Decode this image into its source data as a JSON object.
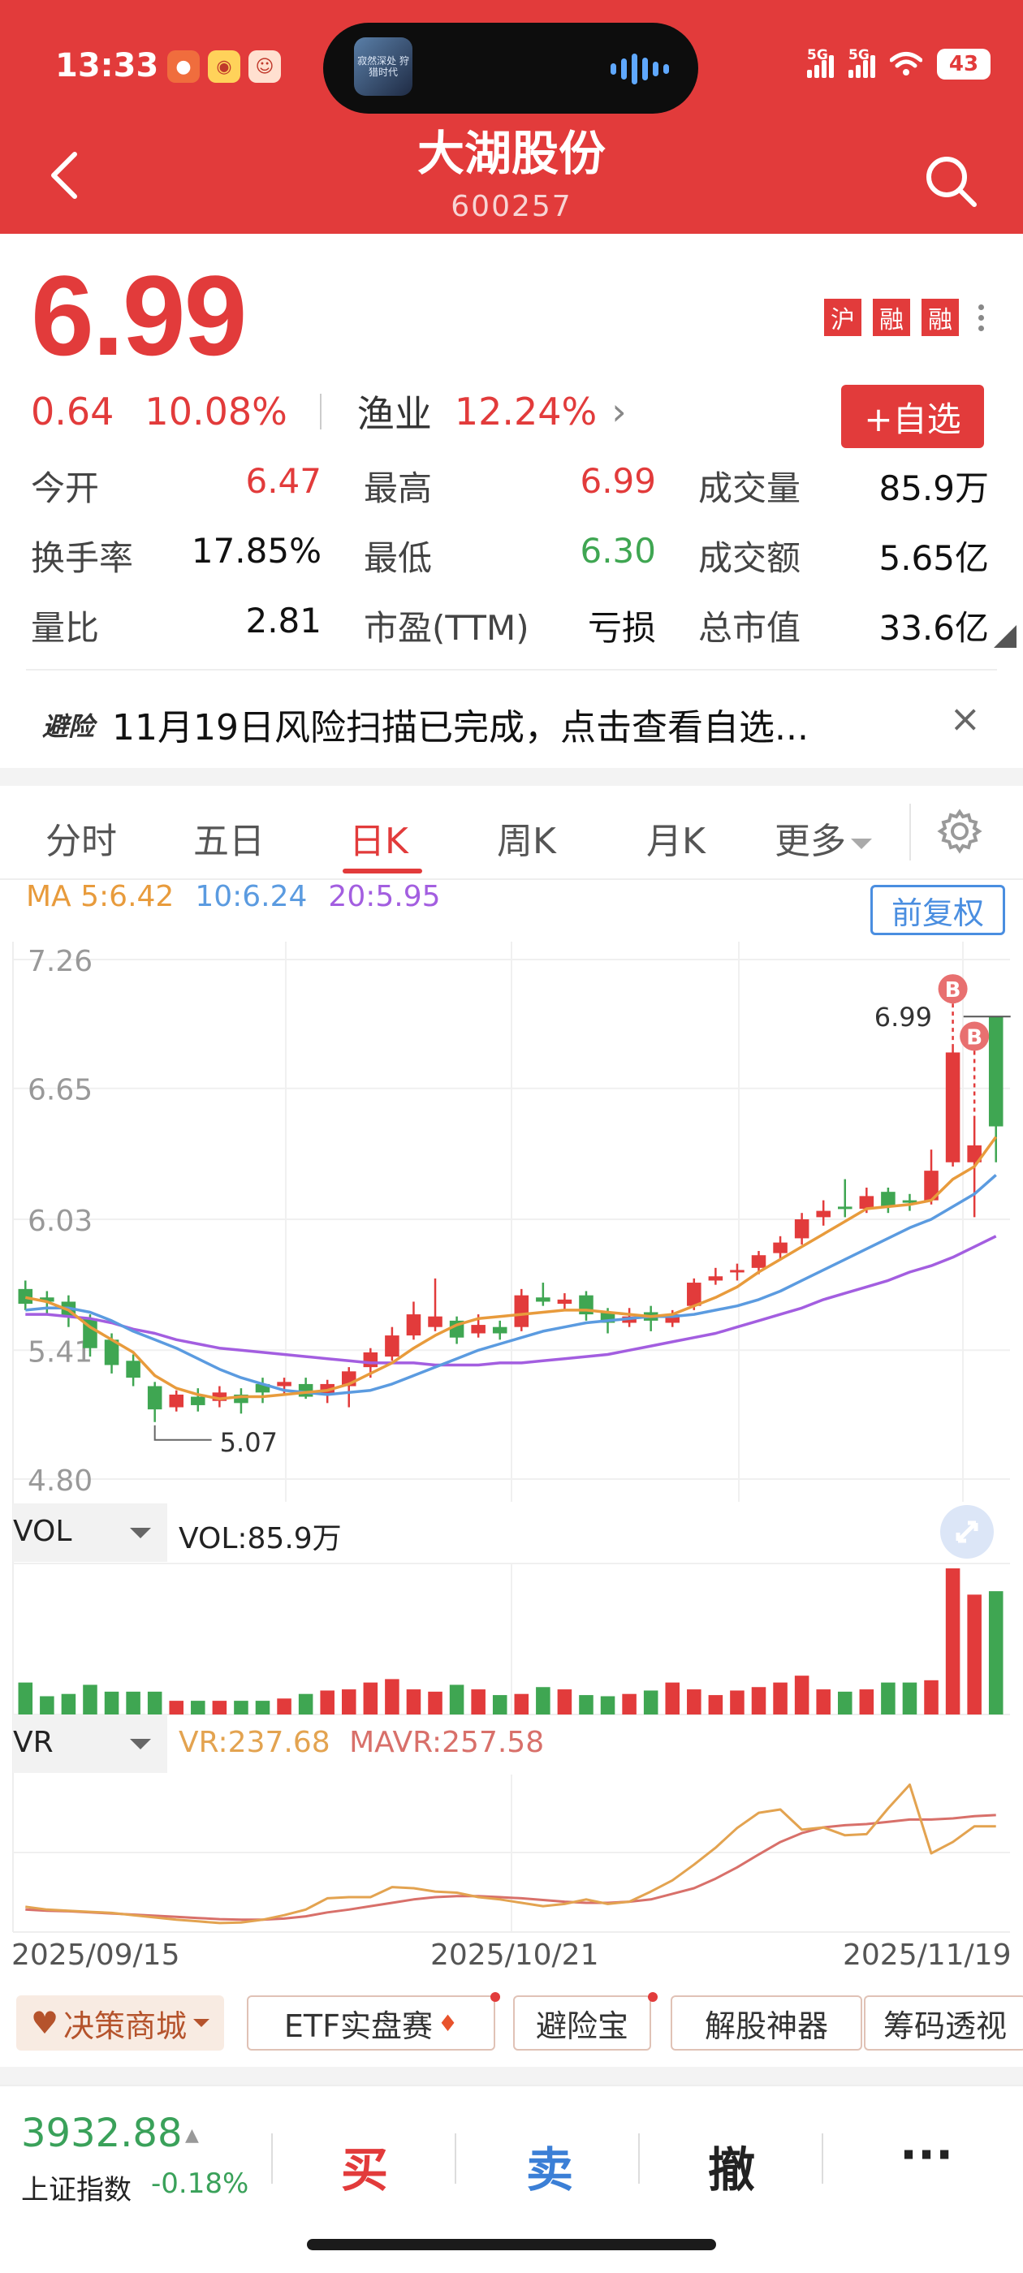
{
  "status_bar": {
    "time": "13:33",
    "battery": "43",
    "net1": "5G",
    "net2": "5G"
  },
  "island": {
    "thumb_text": "寂然深处 狩猎时代"
  },
  "header": {
    "title": "大湖股份",
    "code": "600257"
  },
  "quote": {
    "price": "6.99",
    "change": "0.64",
    "change_pct": "10.08%",
    "sector": "渔业",
    "sector_pct": "12.24%",
    "sector_arrow": "›",
    "market_tags": [
      "沪",
      "融",
      "融"
    ],
    "watch_button": "+自选",
    "stats": [
      {
        "label": "今开",
        "value": "6.47"
      },
      {
        "label": "最高",
        "value": "6.99"
      },
      {
        "label": "成交量",
        "value": "85.9万"
      },
      {
        "label": "换手率",
        "value": "17.85%"
      },
      {
        "label": "最低",
        "value": "6.30"
      },
      {
        "label": "成交额",
        "value": "5.65亿"
      },
      {
        "label": "量比",
        "value": "2.81"
      },
      {
        "label": "市盈(TTM)",
        "value": "亏损"
      },
      {
        "label": "总市值",
        "value": "33.6亿"
      }
    ]
  },
  "announcement": {
    "badge": "避险",
    "text": "11月19日风险扫描已完成，点击查看自选...",
    "close": "×"
  },
  "tabs": {
    "items": [
      "分时",
      "五日",
      "日K",
      "周K",
      "月K",
      "更多"
    ],
    "active": "日K"
  },
  "ma_legend": {
    "ma5": "MA 5:6.42",
    "ma10": "10:6.24",
    "ma20": "20:5.95",
    "adjust_button": "前复权"
  },
  "colors": {
    "up": "#e23b3b",
    "down": "#3fa652",
    "ma5": "#e89b3c",
    "ma10": "#5b9be0",
    "ma20": "#a35ee0",
    "vr": "#e3a350",
    "mavr": "#d8706a"
  },
  "chart_data": [
    {
      "type": "candlestick",
      "title": "日K",
      "y_ticks": [
        "7.26",
        "6.65",
        "6.03",
        "5.41",
        "4.80"
      ],
      "ylim": [
        4.8,
        7.26
      ],
      "x_ticks": [
        "2025/09/15",
        "2025/10/21",
        "2025/11/19"
      ],
      "annotations": [
        {
          "text": "5.07",
          "kind": "low"
        },
        {
          "text": "6.99",
          "kind": "high"
        },
        {
          "text": "B",
          "kind": "buy"
        },
        {
          "text": "B",
          "kind": "buy"
        }
      ],
      "candles": [
        {
          "o": 5.7,
          "c": 5.63,
          "h": 5.74,
          "l": 5.6
        },
        {
          "o": 5.66,
          "c": 5.64,
          "h": 5.69,
          "l": 5.58
        },
        {
          "o": 5.64,
          "c": 5.57,
          "h": 5.67,
          "l": 5.52
        },
        {
          "o": 5.56,
          "c": 5.42,
          "h": 5.58,
          "l": 5.38
        },
        {
          "o": 5.46,
          "c": 5.34,
          "h": 5.49,
          "l": 5.3
        },
        {
          "o": 5.36,
          "c": 5.28,
          "h": 5.39,
          "l": 5.24
        },
        {
          "o": 5.24,
          "c": 5.13,
          "h": 5.26,
          "l": 5.07
        },
        {
          "o": 5.14,
          "c": 5.2,
          "h": 5.22,
          "l": 5.12
        },
        {
          "o": 5.19,
          "c": 5.15,
          "h": 5.23,
          "l": 5.12
        },
        {
          "o": 5.17,
          "c": 5.21,
          "h": 5.24,
          "l": 5.14
        },
        {
          "o": 5.2,
          "c": 5.16,
          "h": 5.23,
          "l": 5.11
        },
        {
          "o": 5.25,
          "c": 5.21,
          "h": 5.28,
          "l": 5.16
        },
        {
          "o": 5.24,
          "c": 5.26,
          "h": 5.28,
          "l": 5.2
        },
        {
          "o": 5.25,
          "c": 5.19,
          "h": 5.28,
          "l": 5.18
        },
        {
          "o": 5.2,
          "c": 5.25,
          "h": 5.27,
          "l": 5.16
        },
        {
          "o": 5.24,
          "c": 5.31,
          "h": 5.33,
          "l": 5.14
        },
        {
          "o": 5.33,
          "c": 5.4,
          "h": 5.42,
          "l": 5.28
        },
        {
          "o": 5.38,
          "c": 5.48,
          "h": 5.52,
          "l": 5.36
        },
        {
          "o": 5.48,
          "c": 5.58,
          "h": 5.64,
          "l": 5.46
        },
        {
          "o": 5.52,
          "c": 5.57,
          "h": 5.75,
          "l": 5.5
        },
        {
          "o": 5.55,
          "c": 5.47,
          "h": 5.57,
          "l": 5.44
        },
        {
          "o": 5.49,
          "c": 5.53,
          "h": 5.58,
          "l": 5.47
        },
        {
          "o": 5.52,
          "c": 5.49,
          "h": 5.55,
          "l": 5.46
        },
        {
          "o": 5.52,
          "c": 5.67,
          "h": 5.7,
          "l": 5.5
        },
        {
          "o": 5.66,
          "c": 5.64,
          "h": 5.73,
          "l": 5.62
        },
        {
          "o": 5.63,
          "c": 5.65,
          "h": 5.68,
          "l": 5.6
        },
        {
          "o": 5.67,
          "c": 5.58,
          "h": 5.69,
          "l": 5.55
        },
        {
          "o": 5.59,
          "c": 5.54,
          "h": 5.61,
          "l": 5.49
        },
        {
          "o": 5.54,
          "c": 5.57,
          "h": 5.61,
          "l": 5.52
        },
        {
          "o": 5.59,
          "c": 5.55,
          "h": 5.62,
          "l": 5.5
        },
        {
          "o": 5.54,
          "c": 5.58,
          "h": 5.6,
          "l": 5.52
        },
        {
          "o": 5.62,
          "c": 5.73,
          "h": 5.75,
          "l": 5.6
        },
        {
          "o": 5.74,
          "c": 5.76,
          "h": 5.8,
          "l": 5.72
        },
        {
          "o": 5.78,
          "c": 5.79,
          "h": 5.82,
          "l": 5.74
        },
        {
          "o": 5.8,
          "c": 5.86,
          "h": 5.88,
          "l": 5.77
        },
        {
          "o": 5.87,
          "c": 5.92,
          "h": 5.95,
          "l": 5.84
        },
        {
          "o": 5.94,
          "c": 6.03,
          "h": 6.06,
          "l": 5.91
        },
        {
          "o": 6.04,
          "c": 6.07,
          "h": 6.12,
          "l": 6.0
        },
        {
          "o": 6.09,
          "c": 6.08,
          "h": 6.22,
          "l": 6.04
        },
        {
          "o": 6.08,
          "c": 6.14,
          "h": 6.18,
          "l": 6.06
        },
        {
          "o": 6.16,
          "c": 6.09,
          "h": 6.18,
          "l": 6.06
        },
        {
          "o": 6.12,
          "c": 6.11,
          "h": 6.15,
          "l": 6.07
        },
        {
          "o": 6.12,
          "c": 6.26,
          "h": 6.36,
          "l": 6.1
        },
        {
          "o": 6.3,
          "c": 6.82,
          "h": 6.86,
          "l": 6.28
        },
        {
          "o": 6.3,
          "c": 6.38,
          "h": 6.52,
          "l": 6.04
        },
        {
          "o": 6.99,
          "c": 6.47,
          "h": 6.99,
          "l": 6.3
        }
      ],
      "ma5": [
        5.66,
        5.64,
        5.6,
        5.52,
        5.46,
        5.4,
        5.29,
        5.23,
        5.2,
        5.18,
        5.19,
        5.19,
        5.2,
        5.21,
        5.22,
        5.25,
        5.3,
        5.35,
        5.42,
        5.48,
        5.53,
        5.56,
        5.57,
        5.58,
        5.59,
        5.6,
        5.6,
        5.59,
        5.58,
        5.57,
        5.58,
        5.62,
        5.66,
        5.71,
        5.78,
        5.84,
        5.9,
        5.96,
        6.02,
        6.08,
        6.09,
        6.1,
        6.12,
        6.22,
        6.28,
        6.42
      ],
      "ma10": [
        5.6,
        5.61,
        5.61,
        5.59,
        5.55,
        5.5,
        5.46,
        5.42,
        5.37,
        5.32,
        5.28,
        5.25,
        5.22,
        5.21,
        5.2,
        5.21,
        5.22,
        5.25,
        5.29,
        5.33,
        5.37,
        5.41,
        5.44,
        5.47,
        5.5,
        5.52,
        5.54,
        5.55,
        5.56,
        5.57,
        5.57,
        5.58,
        5.6,
        5.62,
        5.65,
        5.69,
        5.74,
        5.79,
        5.84,
        5.89,
        5.94,
        5.99,
        6.03,
        6.09,
        6.15,
        6.24
      ],
      "ma20": [
        5.58,
        5.58,
        5.57,
        5.56,
        5.54,
        5.51,
        5.49,
        5.46,
        5.44,
        5.42,
        5.41,
        5.4,
        5.39,
        5.38,
        5.37,
        5.36,
        5.35,
        5.35,
        5.35,
        5.34,
        5.34,
        5.34,
        5.35,
        5.35,
        5.36,
        5.37,
        5.38,
        5.39,
        5.41,
        5.43,
        5.45,
        5.47,
        5.49,
        5.52,
        5.55,
        5.58,
        5.61,
        5.65,
        5.68,
        5.71,
        5.74,
        5.78,
        5.81,
        5.85,
        5.9,
        5.95
      ]
    },
    {
      "type": "bar",
      "title": "VOL",
      "legend": "VOL:85.9万",
      "values": [
        2.8,
        1.6,
        1.8,
        2.6,
        2.0,
        2.0,
        2.0,
        1.2,
        1.2,
        1.2,
        1.2,
        1.2,
        1.4,
        1.8,
        2.1,
        2.2,
        2.8,
        3.1,
        2.2,
        2.0,
        2.6,
        2.2,
        1.7,
        1.8,
        2.4,
        2.2,
        1.7,
        1.6,
        1.8,
        2.1,
        2.8,
        2.2,
        1.7,
        2.1,
        2.4,
        2.8,
        3.4,
        2.2,
        2.0,
        2.2,
        2.8,
        2.8,
        3.0,
        12.8,
        10.5,
        10.8
      ]
    },
    {
      "type": "line",
      "title": "VR",
      "legend_vr": "VR:237.68",
      "legend_mavr": "MAVR:257.58",
      "series": [
        {
          "name": "VR",
          "values": [
            95,
            90,
            88,
            86,
            84,
            80,
            76,
            72,
            69,
            66,
            67,
            72,
            80,
            90,
            110,
            112,
            112,
            130,
            128,
            122,
            120,
            112,
            108,
            102,
            96,
            100,
            108,
            100,
            104,
            122,
            142,
            170,
            200,
            235,
            262,
            268,
            232,
            236,
            222,
            224,
            270,
            312,
            190,
            210,
            238,
            238
          ]
        },
        {
          "name": "MAVR",
          "values": [
            90,
            88,
            87,
            85,
            83,
            81,
            79,
            77,
            75,
            73,
            72,
            72,
            74,
            78,
            85,
            90,
            96,
            102,
            108,
            112,
            114,
            114,
            112,
            110,
            107,
            104,
            102,
            102,
            104,
            108,
            118,
            128,
            145,
            165,
            188,
            210,
            226,
            236,
            240,
            242,
            246,
            250,
            250,
            252,
            256,
            258
          ]
        }
      ]
    }
  ],
  "chips": [
    "决策商城",
    "ETF实盘赛",
    "避险宝",
    "解股神器",
    "筹码透视"
  ],
  "bottom_bar": {
    "index_value": "3932.88",
    "index_arrow": "▲",
    "index_name": "上证指数",
    "index_change": "-0.18%",
    "buy": "买",
    "sell": "卖",
    "cancel": "撤",
    "more": "···"
  }
}
